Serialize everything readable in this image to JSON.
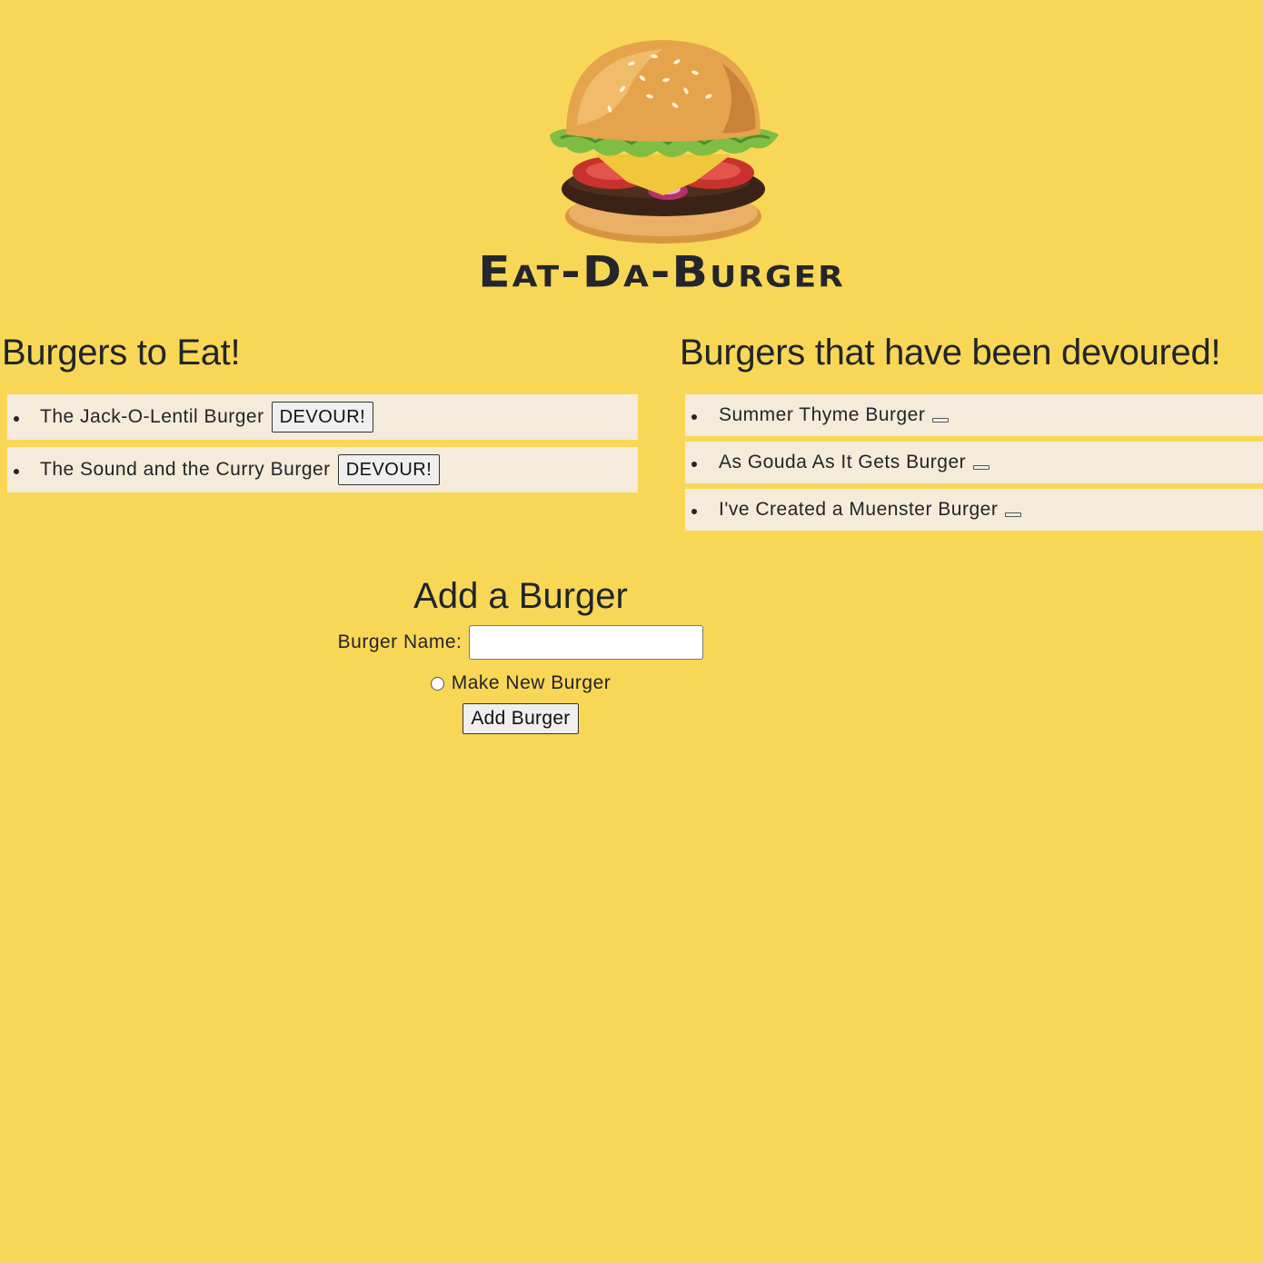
{
  "header": {
    "logo_icon": "burger-icon",
    "title": "Eat-Da-Burger"
  },
  "to_eat": {
    "heading": "Burgers to Eat!",
    "items": [
      {
        "name": "The Jack-O-Lentil Burger",
        "button": "DEVOUR!"
      },
      {
        "name": "The Sound and the Curry Burger",
        "button": "DEVOUR!"
      }
    ]
  },
  "devoured": {
    "heading": "Burgers that have been devoured!",
    "items": [
      {
        "name": "Summer Thyme Burger"
      },
      {
        "name": "As Gouda As It Gets Burger"
      },
      {
        "name": "I've Created a Muenster Burger"
      }
    ]
  },
  "add_form": {
    "heading": "Add a Burger",
    "name_label": "Burger Name:",
    "name_value": "",
    "radio_label": "Make New Burger",
    "submit_label": "Add Burger"
  },
  "colors": {
    "background": "#f8d757",
    "list_item_bg": "#f5ebda",
    "text": "#212529"
  }
}
